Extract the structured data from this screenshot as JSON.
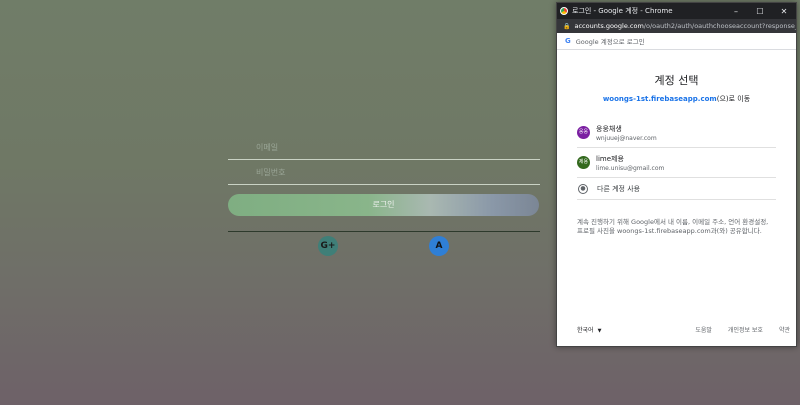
{
  "login_form": {
    "email_placeholder": "이메일",
    "password_placeholder": "비밀번호",
    "login_button": "로그인",
    "google_button_icon": "G+",
    "other_button_icon": "A"
  },
  "popup": {
    "window_title": "로그인 - Google 계정 - Chrome",
    "window_controls": [
      "–",
      "☐",
      "✕"
    ],
    "url_host": "accounts.google.com",
    "url_path": "/o/oauth2/auth/oauthchooseaccount?response_ty...",
    "signin_header": "Google 계정으로 로그인",
    "heading": "계정 선택",
    "continue_link": "woongs-1st.firebaseapp.com",
    "continue_suffix": "(으)로 이동",
    "accounts": [
      {
        "avatar_text": "웅웅",
        "avatar_color": "#7b1fa2",
        "name": "웅웅채생",
        "email": "wnjuuej@naver.com"
      },
      {
        "avatar_text": "제용",
        "avatar_color": "#33691e",
        "name": "lime제용",
        "email": "lime.unisu@gmail.com"
      }
    ],
    "other_account": "다른 계정 사용",
    "consent_text": "계속 진행하기 위해 Google에서 내 이름, 이메일 주소, 언어 환경설정, 프로필 사진을 woongs-1st.firebaseapp.com과(와) 공유합니다.",
    "footer": {
      "language": "한국어",
      "help": "도움말",
      "privacy": "개인정보 보호",
      "terms": "약관"
    }
  }
}
